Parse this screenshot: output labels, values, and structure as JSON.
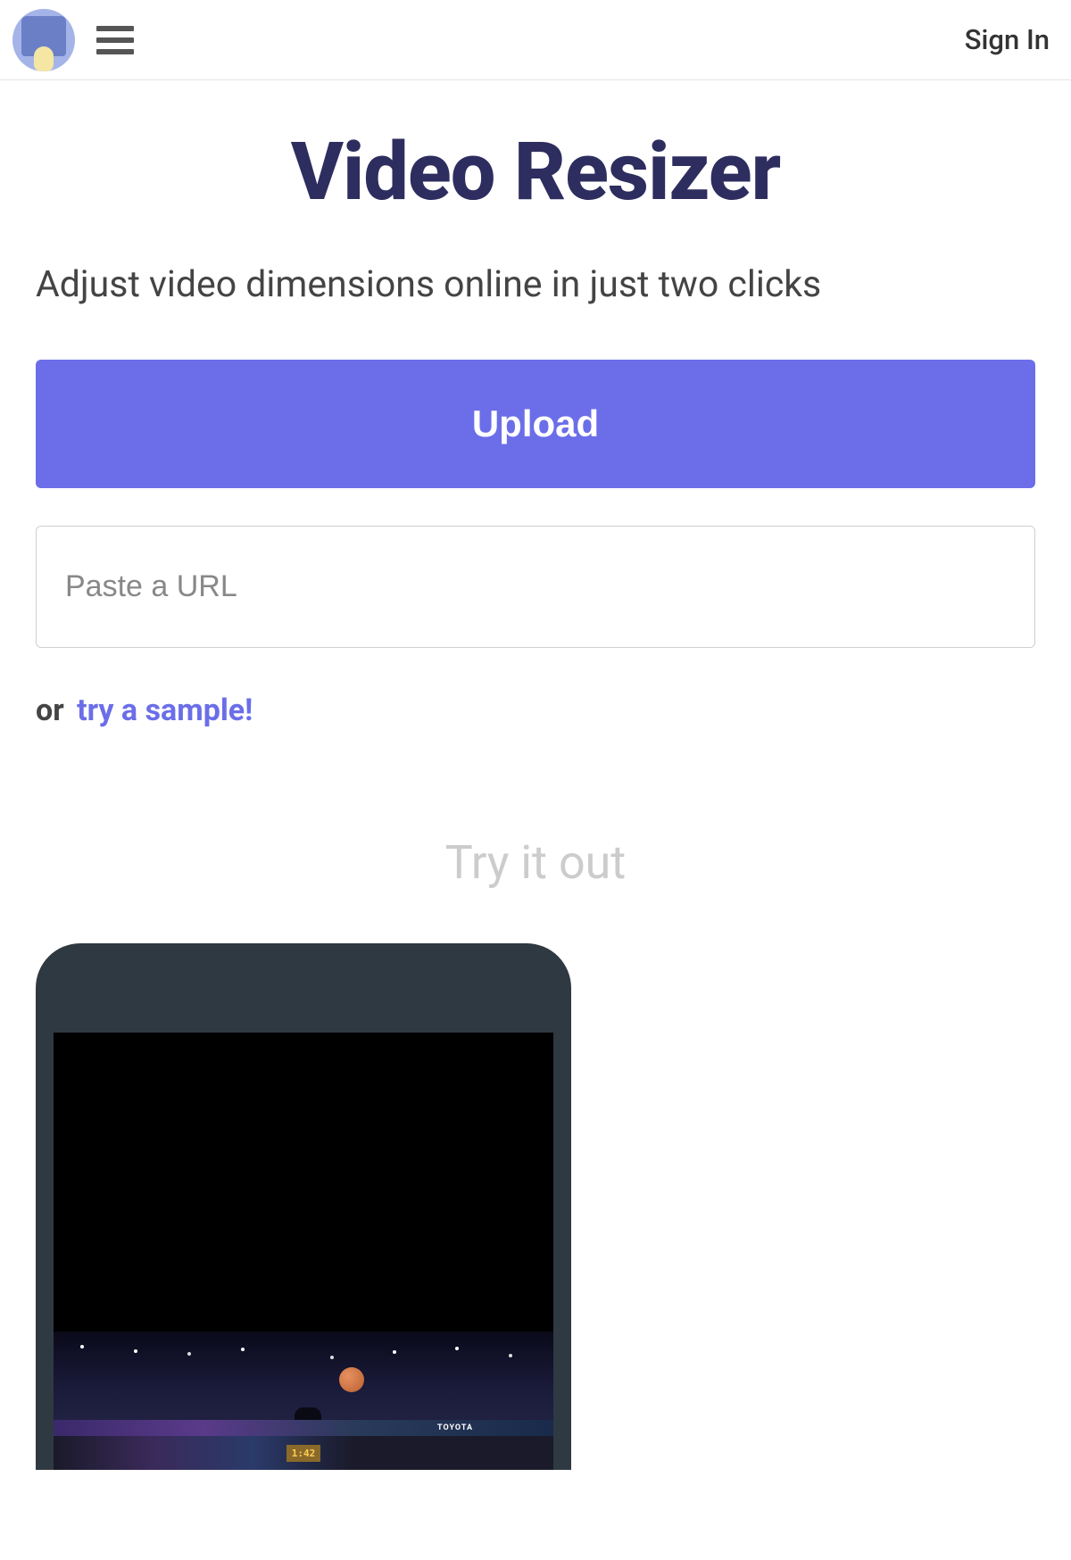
{
  "header": {
    "sign_in_label": "Sign In"
  },
  "main": {
    "title": "Video Resizer",
    "subtitle": "Adjust video dimensions online in just two clicks",
    "upload_button_label": "Upload",
    "url_input_placeholder": "Paste a URL",
    "or_text": "or",
    "sample_link_text": "try a sample!",
    "try_it_out_heading": "Try it out"
  },
  "video_preview": {
    "time_display": "1:42",
    "sponsor_text": "TOYOTA"
  }
}
